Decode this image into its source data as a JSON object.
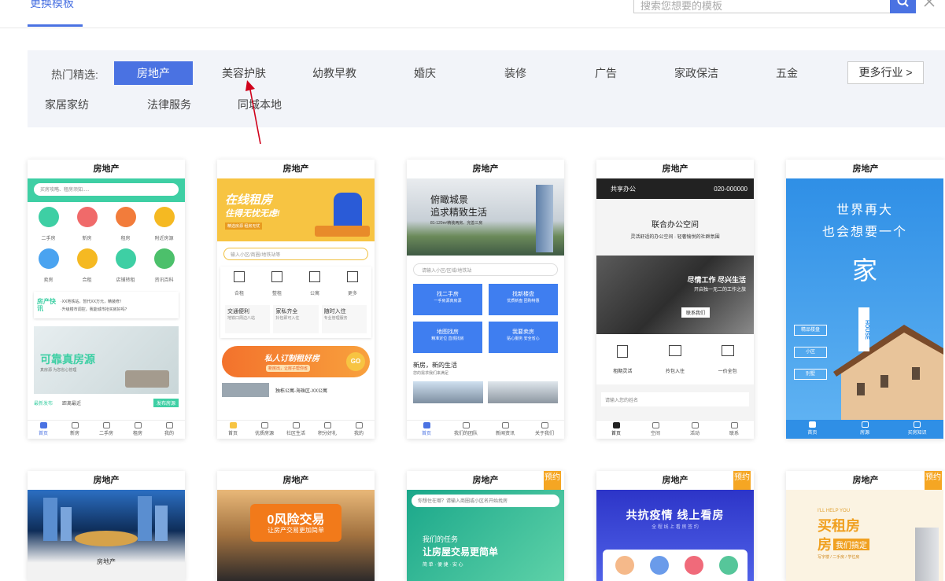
{
  "topbar": {
    "active_tab": "更换模板",
    "search_placeholder": "搜索您想要的模板"
  },
  "filter": {
    "label": "热门精选:",
    "categories": [
      "房地产",
      "美容护肤",
      "幼教早教",
      "婚庆",
      "装修",
      "广告",
      "家政保洁",
      "五金",
      "家居家纺",
      "法律服务",
      "同城本地"
    ],
    "active": "房地产",
    "more_label": "更多行业 >"
  },
  "colors": {
    "accent": "#4a72e2",
    "panel": "#f2f4f9",
    "badge": "#f5a623"
  },
  "cards": {
    "c1": {
      "title": "房地产",
      "search": "买房攻略、租房须知.....",
      "icons": [
        "二手房",
        "新房",
        "租房",
        "附近房源",
        "卖房",
        "合租",
        "店铺转租",
        "资讯百科"
      ],
      "news_brand": "房产快讯",
      "news1": "·XX地铁站，暂代XX万元，精装修！",
      "news2": "·升级楼市调控，我能城市抢买房好吗？",
      "banner": "可靠真房源",
      "banner_sub": "真房源 为您省心管理",
      "foot_left": "最新发布",
      "foot_mid": "距离最近",
      "foot_btn": "发布房源",
      "nav": [
        "首页",
        "新房",
        "二手房",
        "租房",
        "我的"
      ]
    },
    "c2": {
      "title": "房地产",
      "banner1": "在线租房",
      "banner2": "住得无忧无虑!",
      "banner3": "精选房源 租房无忧",
      "search": "输入小区/商圈/地铁站等",
      "icons": [
        "合租",
        "整租",
        "公寓",
        "更多"
      ],
      "tiles": [
        [
          "交通便利",
          "地铁口周边八站"
        ],
        [
          "家私齐全",
          "拎包即可入住"
        ],
        [
          "随时入住",
          "专业管理服务"
        ]
      ],
      "promo": "私人订制租好房",
      "promo_sub": "新房出，让房子帮你省",
      "promo_go": "GO",
      "listing": "独栋公寓-海珠区-XX公寓",
      "nav": [
        "首页",
        "优质房源",
        "社区生活",
        "积分好礼",
        "我的"
      ]
    },
    "c3": {
      "title": "房地产",
      "hero1": "俯瞰城景",
      "hero2": "追求精致生活",
      "hero3": "81-120m²精装两房、完善三房",
      "search": "请输入小区/区域/地铁站",
      "buttons": [
        [
          "找二手房",
          "一手房源真房源"
        ],
        [
          "找新楼盘",
          "优质新盘 团购特惠"
        ],
        [
          "地图找房",
          "精准定位 直观找房"
        ],
        [
          "我要卖房",
          "贴心服务 安全省心"
        ]
      ],
      "section": "新房，新的生活",
      "section_sub": "您的需求我们来满足",
      "nav": [
        "首页",
        "我们的团队",
        "新闻资讯",
        "关于我们"
      ]
    },
    "c4": {
      "title": "房地产",
      "brand": "共享办公",
      "phone": "020-000000",
      "head1": "联合办公空间",
      "head2": "灵活舒适的办公空间 · 轻奢愉悦的社群氛围",
      "photo1": "尽情工作 尽兴生活",
      "photo2": "开启独一无二的工作之旅",
      "photo_btn": "联系我们",
      "features": [
        "租期灵活",
        "拎包入住",
        "一价全包"
      ],
      "input": "请输入您的姓名",
      "nav": [
        "首页",
        "空间",
        "活动",
        "联系"
      ]
    },
    "c5": {
      "title": "房地产",
      "line1": "世界再大",
      "line2": "也会想要一个",
      "big": "家",
      "tags": [
        "精品楼盘",
        "小区",
        "别墅"
      ],
      "house": "HOUSE",
      "nav": [
        "首页",
        "房源",
        "买房知识"
      ]
    },
    "c6": {
      "title": "房地产",
      "caption": "房地产"
    },
    "c7": {
      "title": "房地产",
      "hero1": "0风险交易",
      "hero2": "让房产交易更加简单"
    },
    "c8": {
      "title": "房地产",
      "badge": "预约",
      "search": "你想住在哪？请输入商圈或小区名开始找房",
      "hero1": "我们的任务",
      "hero2": "让房屋交易更简单",
      "hero3": "简 单 · 便 捷 · 安 心"
    },
    "c9": {
      "title": "房地产",
      "badge": "预约",
      "hero": "共抗疫情 线上看房",
      "hero_sub": "全 程 线 上 看 房 签 约"
    },
    "c10": {
      "title": "房地产",
      "badge": "预约",
      "en": "I'LL HELP YOU",
      "hero1": "买租房",
      "hero2": "房",
      "hero3": "我们搞定",
      "hero_sub": "写字楼 / 二手房 / 学位房"
    }
  }
}
